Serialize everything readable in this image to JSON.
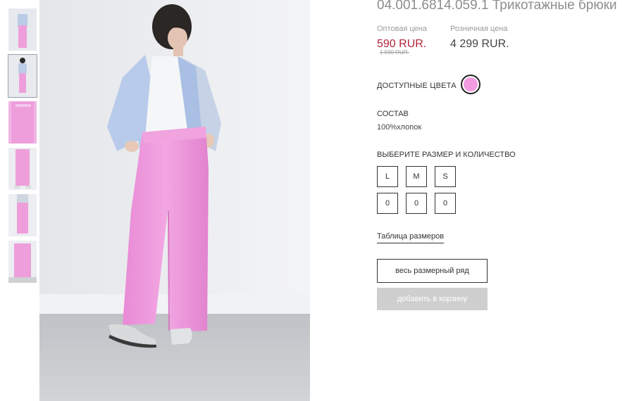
{
  "product": {
    "title": "04.001.6814.059.1 Трикотажные брюки"
  },
  "prices": {
    "wholesale_label": "Оптовая цена",
    "wholesale_value": "590 RUR.",
    "wholesale_old": "1 590 RUR.",
    "retail_label": "Розничная цена",
    "retail_value": "4 299 RUR."
  },
  "colors": {
    "label": "ДОСТУПНЫЕ ЦВЕТА",
    "swatch_color": "#f29be0"
  },
  "composition": {
    "label": "СОСТАВ",
    "value": "100%хлопок"
  },
  "sizes": {
    "label": "ВЫБЕРИТЕ РАЗМЕР И КОЛИЧЕСТВО",
    "items": [
      {
        "size": "L",
        "qty": "0"
      },
      {
        "size": "M",
        "qty": "0"
      },
      {
        "size": "S",
        "qty": "0"
      }
    ]
  },
  "size_table_link": "Таблица размеров",
  "buttons": {
    "full_range": "весь размерный ряд",
    "add_to_cart": "добавить в корзину"
  },
  "gallery": {
    "thumbnail_count": 6,
    "active_index": 1
  },
  "colors_palette": {
    "accent_price": "#b2243a",
    "disabled_button": "#cfcfcf",
    "pants_pink": "#ef9fdc"
  }
}
